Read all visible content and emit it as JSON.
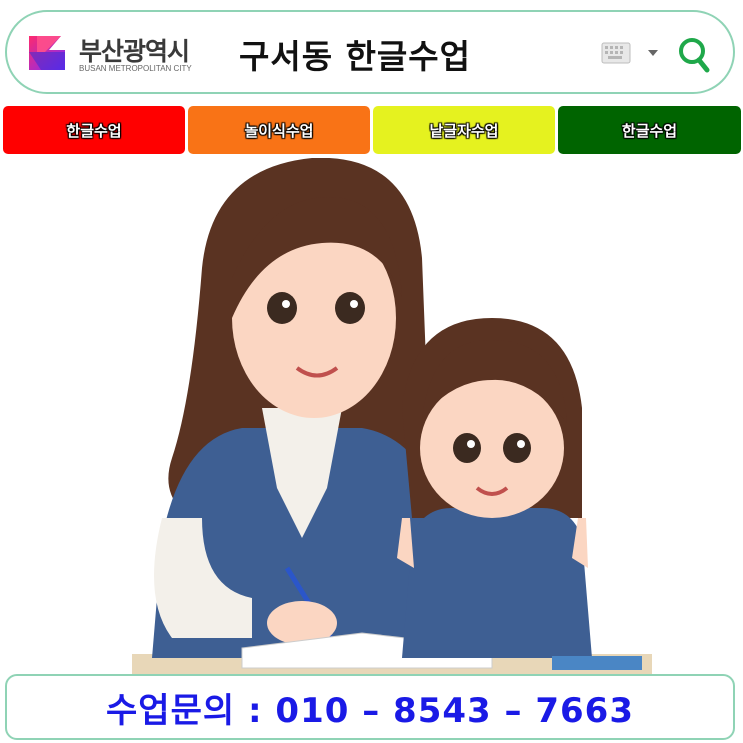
{
  "header": {
    "logo": {
      "name": "부산광역시",
      "subtitle": "BUSAN METROPOLITAN CITY",
      "icon": "busan-logo-icon"
    },
    "search": {
      "query": "구서동 한글수업"
    },
    "icons": [
      "keyboard-icon",
      "chevron-down-icon",
      "search-icon"
    ]
  },
  "tabs": [
    {
      "label": "한글수업",
      "color": "#ff0000"
    },
    {
      "label": "놀이식수업",
      "color": "#f97316"
    },
    {
      "label": "낱글자수업",
      "color": "#e5f21f"
    },
    {
      "label": "한글수업",
      "color": "#006400"
    }
  ],
  "illustration": {
    "subject": "teacher and child"
  },
  "contact": {
    "text": "수업문의 : 010 – 8543 – 7663",
    "color": "#1a1ae6"
  },
  "colors": {
    "border": "#8fd3b5",
    "search_green": "#1fa84a"
  }
}
